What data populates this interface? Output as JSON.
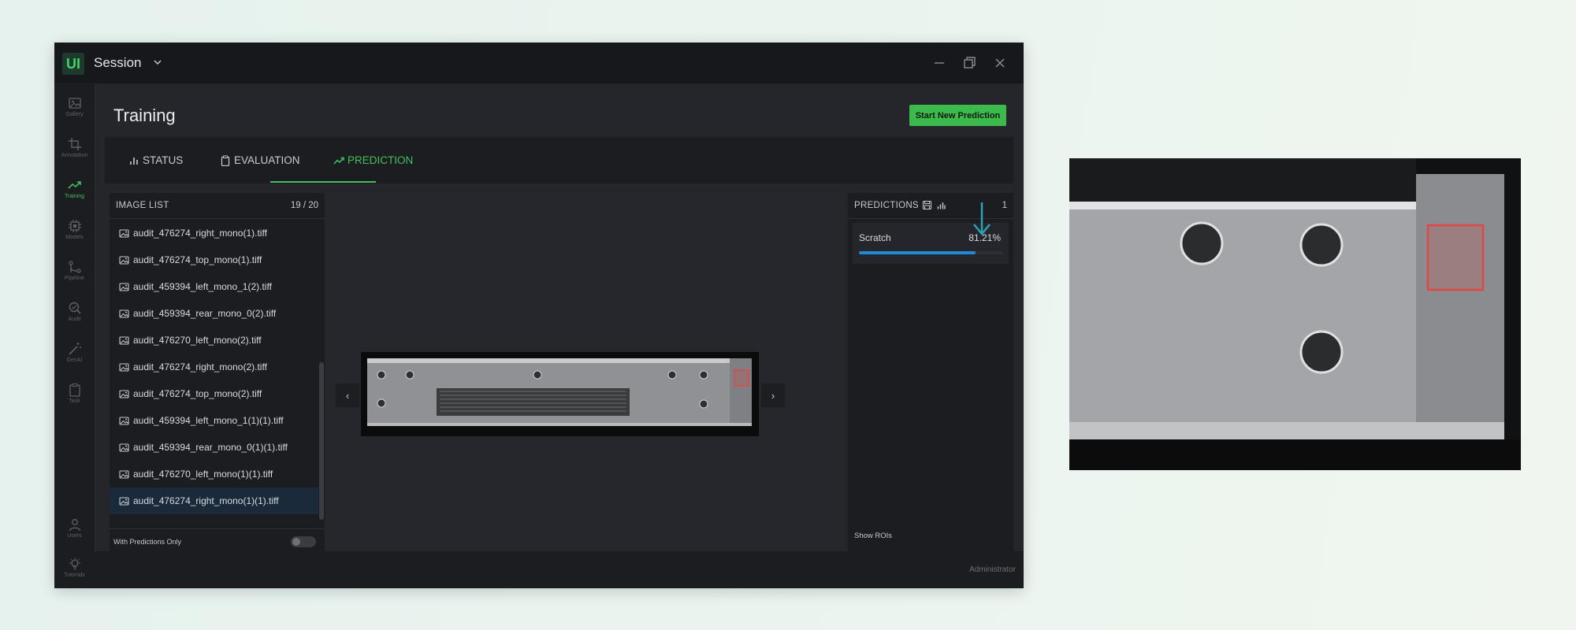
{
  "app": {
    "logo_text": "UI",
    "session_title": "Session",
    "page_title": "Training",
    "start_button": "Start New Prediction",
    "status_user": "Administrator"
  },
  "sidebar": {
    "items": [
      {
        "label": "Gallery",
        "icon": "image-icon"
      },
      {
        "label": "Annotation",
        "icon": "crop-icon"
      },
      {
        "label": "Training",
        "icon": "trend-icon",
        "active": true
      },
      {
        "label": "Models",
        "icon": "chip-icon"
      },
      {
        "label": "Pipeline",
        "icon": "branch-icon"
      },
      {
        "label": "Audit",
        "icon": "search-icon"
      },
      {
        "label": "GenAI",
        "icon": "wand-icon"
      },
      {
        "label": "Task",
        "icon": "clipboard-icon"
      }
    ],
    "bottom": [
      {
        "label": "Users",
        "icon": "user-icon"
      },
      {
        "label": "Tutorials",
        "icon": "bulb-icon"
      }
    ]
  },
  "tabs": [
    {
      "label": "STATUS",
      "icon": "bar-chart-icon"
    },
    {
      "label": "EVALUATION",
      "icon": "clipboard-icon"
    },
    {
      "label": "PREDICTION",
      "icon": "trend-icon",
      "active": true
    }
  ],
  "image_list": {
    "title": "IMAGE LIST",
    "count": "19 / 20",
    "files": [
      "audit_476274_right_mono(1).tiff",
      "audit_476274_top_mono(1).tiff",
      "audit_459394_left_mono_1(2).tiff",
      "audit_459394_rear_mono_0(2).tiff",
      "audit_476270_left_mono(2).tiff",
      "audit_476274_right_mono(2).tiff",
      "audit_476274_top_mono(2).tiff",
      "audit_459394_left_mono_1(1)(1).tiff",
      "audit_459394_rear_mono_0(1)(1).tiff",
      "audit_476270_left_mono(1)(1).tiff",
      "audit_476274_right_mono(1)(1).tiff"
    ],
    "selected_index": 10,
    "footer_label": "With Predictions Only"
  },
  "viewer": {
    "prev": "‹",
    "next": "›"
  },
  "predictions": {
    "title": "PREDICTIONS",
    "count": "1",
    "items": [
      {
        "label": "Scratch",
        "value": "81.21%",
        "fraction": 0.8121
      }
    ],
    "show_rois_label": "Show ROIs"
  },
  "colors": {
    "accent_green": "#3cba4c",
    "bar_blue": "#1f8ad8",
    "roi_red": "#e04848",
    "annotation_arrow": "#2aa4b5"
  }
}
